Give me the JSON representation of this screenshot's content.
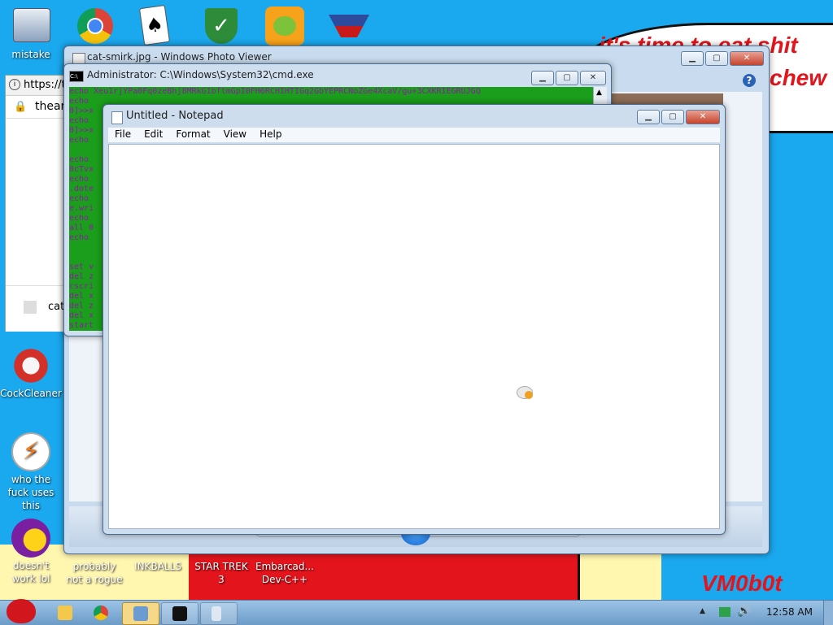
{
  "wallpaper": {
    "bubble_line1": "it's time to eat shit",
    "bubble_line2": "chew",
    "signature": "VM0b0t"
  },
  "desktop_icons": [
    {
      "label": "mistake"
    },
    {
      "label": "CockCleaner"
    },
    {
      "label": "who the fuck uses this"
    },
    {
      "label": "doesn't work lol"
    },
    {
      "label": "probably not a rogue"
    },
    {
      "label": "INKBALLS"
    },
    {
      "label": "STAR TREK 3"
    },
    {
      "label": "Embarcad... Dev-C++"
    }
  ],
  "photo_viewer": {
    "title": "cat-smirk.jpg - Windows Photo Viewer"
  },
  "browser": {
    "url": "https://t",
    "tab_text": "thear",
    "item": "cat"
  },
  "cmd": {
    "title": "Administrator: C:\\Windows\\System32\\cmd.exe",
    "top_line": "echo  Xeu1rjYPa0Fq0zeBhj8MRkG1bftmGpI0FH6RCHIHTIGq2GbYEPRCNoZGe4XcaV/gu+3CXKRIEGRUJGQ",
    "lines": [
      "echo",
      "0]>>x",
      "echo",
      "0]>>x",
      "echo",
      "",
      "echo",
      "0cTvx",
      "echo",
      ".dote",
      "echo",
      "e.wri",
      "echo",
      "all 0",
      "echo",
      "",
      "",
      "set v",
      "del z",
      "cscri",
      "del x",
      "del z",
      "del x",
      "start"
    ]
  },
  "notepad": {
    "title": "Untitled - Notepad",
    "menu": [
      "File",
      "Edit",
      "Format",
      "View",
      "Help"
    ],
    "content": ""
  },
  "taskbar": {
    "clock": "12:58 AM"
  },
  "colors": {
    "cmd_bg": "#1b9e1b",
    "cmd_text": "#8e1aa6",
    "wall_red": "#e3141c",
    "desktop_blue": "#1aa8ee"
  }
}
